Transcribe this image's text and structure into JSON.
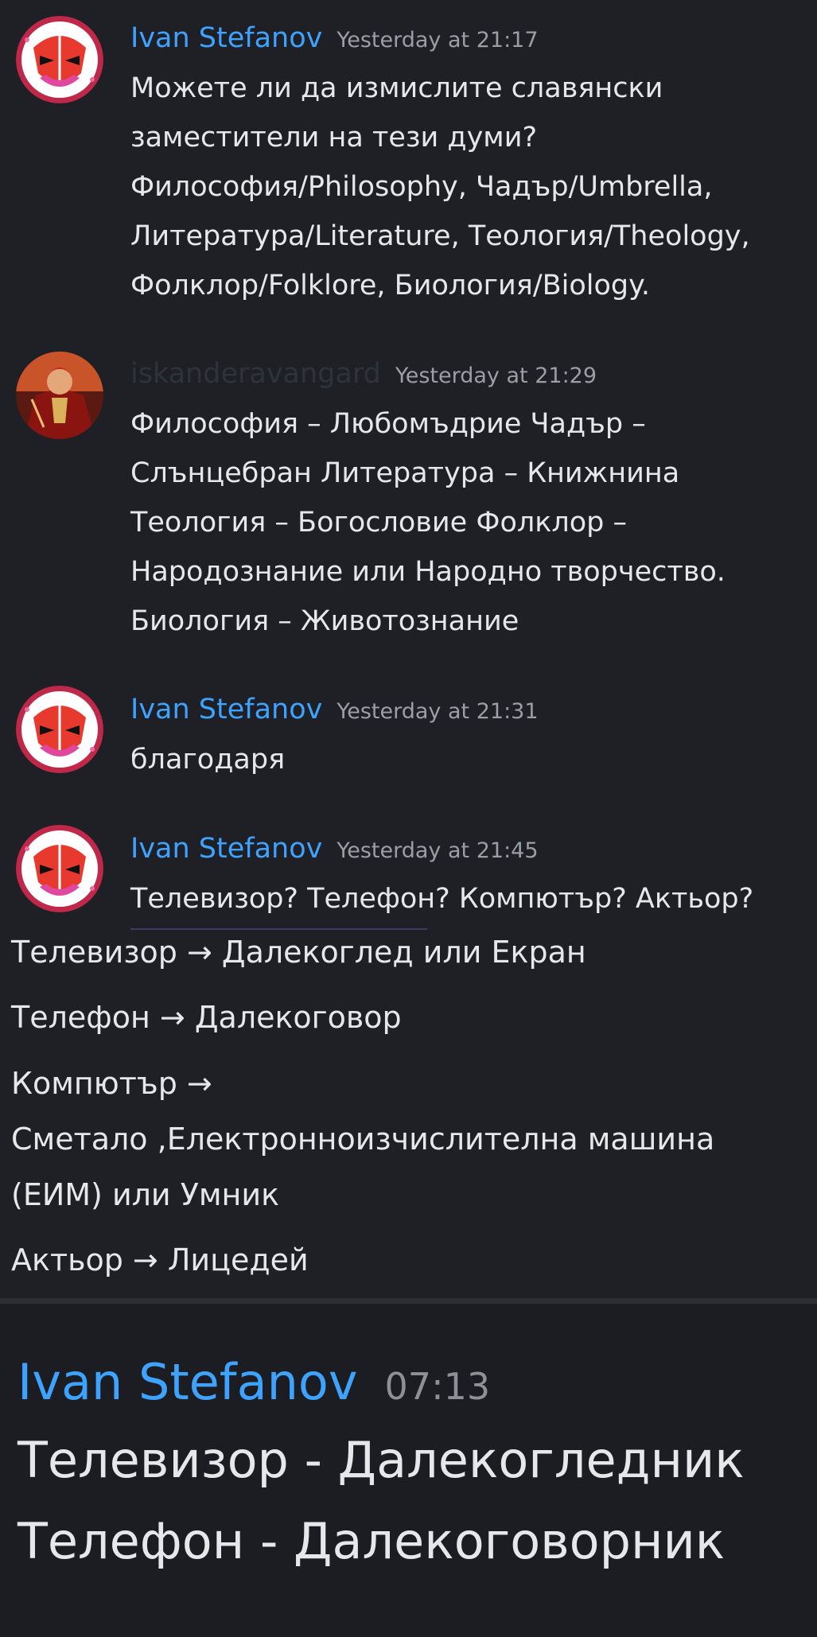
{
  "messages": [
    {
      "author": "Ivan Stefanov",
      "timestamp": "Yesterday at 21:17",
      "lines": [
        "Можете ли да измислите славянски",
        "заместители на тези думи?",
        "Философия/Philosophy, Чадър/Umbrella,",
        "Литература/Literature, Теология/Theology,",
        "Фолклор/Folklore, Биология/Biology."
      ]
    },
    {
      "author": "iskanderavangard",
      "timestamp": "Yesterday at 21:29",
      "lines": [
        "Философия – Любомъдрие Чадър –",
        "Слънцебран Литература – Книжнина",
        "Теология – Богословие Фолклор –",
        "Народознание или Народно творчество.",
        "Биология – Животознание"
      ]
    },
    {
      "author": "Ivan Stefanov",
      "timestamp": "Yesterday at 21:31",
      "lines": [
        "благодаря"
      ]
    },
    {
      "author": "Ivan Stefanov",
      "timestamp": "Yesterday at 21:45",
      "lines": [
        "Телевизор? Телефон? Компютър? Актьор?"
      ]
    }
  ],
  "reply_lines": [
    "Телевизор → Далекоглед или Екран",
    "Телефон → Далекоговор",
    "Компютър →",
    "Сметало ,Електронноизчислителна машина",
    "(ЕИМ) или Умник",
    "Актьор → Лицедей"
  ],
  "zoom": {
    "author": "Ivan Stefanov",
    "timestamp": "07:13",
    "lines": [
      "Телевизор - Далекогледник",
      "Телефон - Далекоговорник"
    ]
  },
  "icons": {
    "avatar_ivan": "red-mask-avatar-icon",
    "avatar_iskander": "red-caped-warrior-avatar-icon"
  },
  "colors": {
    "background": "#1f2025",
    "author_name": "#3ea3ff",
    "timestamp": "#9a9ea6",
    "text": "#e6e7ea"
  }
}
